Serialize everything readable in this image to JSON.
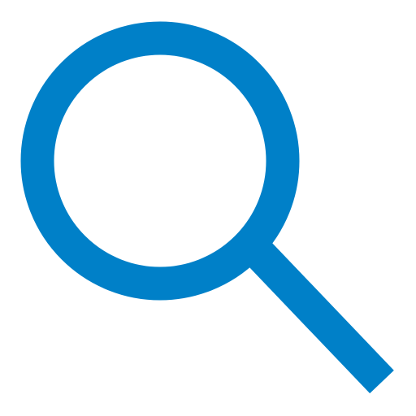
{
  "icon": {
    "name": "search-icon",
    "color": "#0080C8",
    "background": "#FFFFFF"
  }
}
